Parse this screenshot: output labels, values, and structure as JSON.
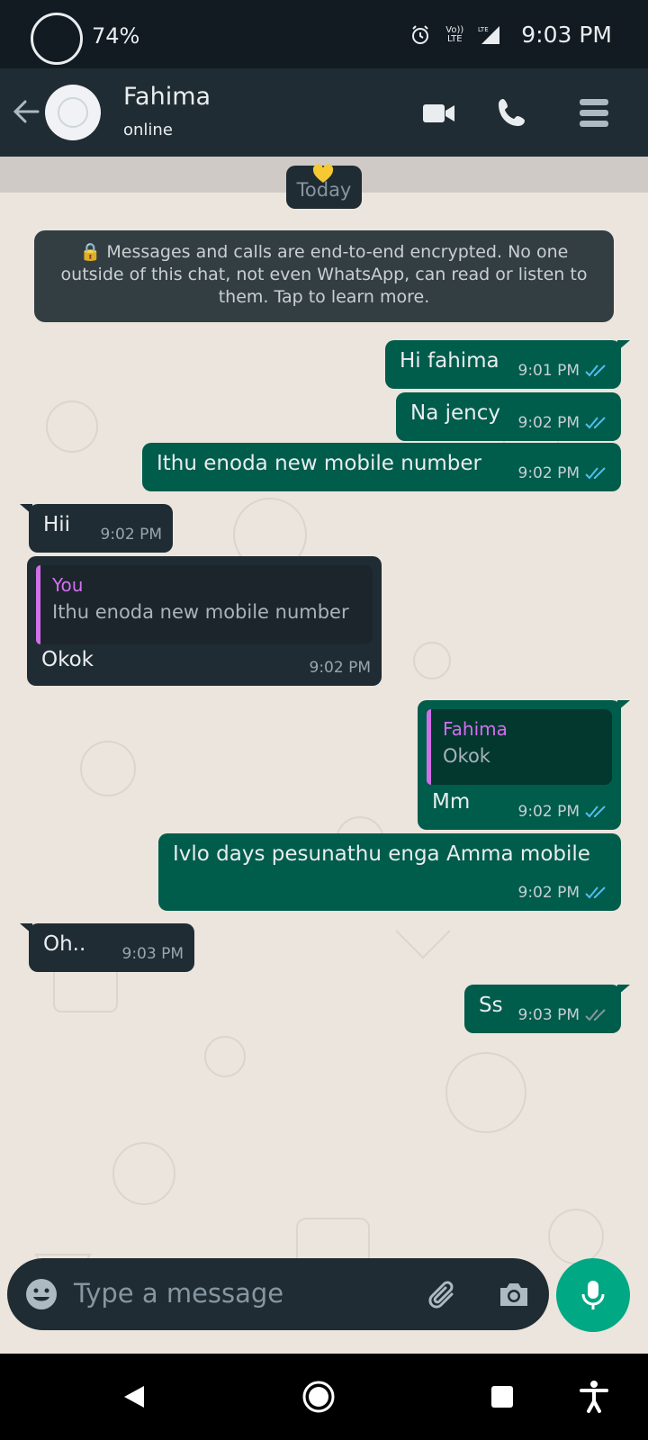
{
  "status_bar": {
    "battery": "74%",
    "network_top": "Vo)) LTE",
    "network_lte": "LTE",
    "time": "9:03 PM"
  },
  "header": {
    "contact_name": "Fahima",
    "contact_status": "online"
  },
  "chat": {
    "date_chip": "Today",
    "encryption_notice": "🔒 Messages and calls are end-to-end encrypted. No one outside of this chat, not even WhatsApp, can read or listen to them. Tap to learn more.",
    "messages": [
      {
        "dir": "out",
        "text": "Hi fahima",
        "time": "9:01 PM",
        "status": "read"
      },
      {
        "dir": "out",
        "text": "Na jency",
        "time": "9:02 PM",
        "status": "read"
      },
      {
        "dir": "out",
        "text": "Ithu enoda new mobile number",
        "time": "9:02 PM",
        "status": "read"
      },
      {
        "dir": "in",
        "text": "Hii",
        "time": "9:02 PM"
      },
      {
        "dir": "in",
        "quote_name": "You",
        "quote_text": "Ithu enoda new mobile number",
        "text": "Okok",
        "time": "9:02 PM"
      },
      {
        "dir": "out",
        "quote_name": "Fahima",
        "quote_text": "Okok",
        "text": "Mm",
        "time": "9:02 PM",
        "status": "read"
      },
      {
        "dir": "out",
        "text": "Ivlo days pesunathu enga Amma mobile",
        "time": "9:02 PM",
        "status": "read"
      },
      {
        "dir": "in",
        "text": "Oh..",
        "time": "9:03 PM"
      },
      {
        "dir": "out",
        "text": "Ss",
        "time": "9:03 PM",
        "status": "delivered"
      }
    ]
  },
  "composer": {
    "placeholder": "Type a message"
  },
  "icons": {
    "back": "arrow-left-icon",
    "video": "video-camera-icon",
    "call": "phone-icon",
    "menu": "menu-icon",
    "emoji": "emoji-icon",
    "attach": "paperclip-icon",
    "camera": "camera-icon",
    "mic": "microphone-icon",
    "read_color": "#53bdeb",
    "delivered_color": "#8696a0",
    "accent": "#00a884"
  }
}
